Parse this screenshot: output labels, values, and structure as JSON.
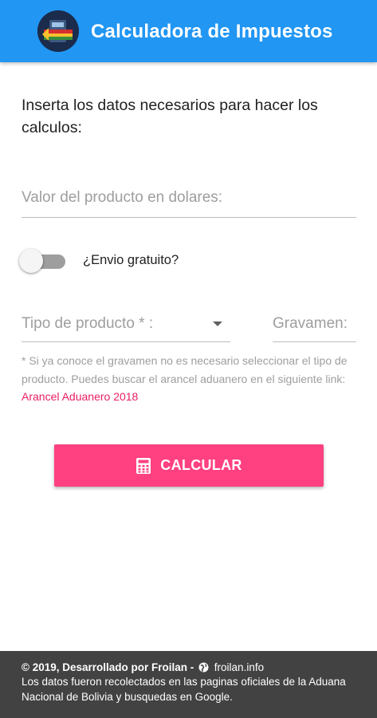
{
  "appbar": {
    "title": "Calculadora de Impuestos",
    "color": "#2196f3",
    "logo_icon": "calculator-money-logo"
  },
  "intro": {
    "text": "Inserta los datos necesarios para hacer los calculos:"
  },
  "form": {
    "valor": {
      "placeholder": "Valor del producto en dolares:",
      "value": ""
    },
    "envio": {
      "label": "¿Envio gratuito?",
      "checked": false
    },
    "tipo": {
      "placeholder": "Tipo de producto * :",
      "icon": "dropdown-arrow-icon"
    },
    "gravamen": {
      "placeholder": "Gravamen:",
      "value": ""
    },
    "help": {
      "text": "* Si ya conoce el gravamen no es necesario seleccionar el tipo de producto. Puedes buscar el arancel aduanero en el siguiente link: ",
      "link_text": "Arancel Aduanero 2018"
    }
  },
  "button": {
    "label": "CALCULAR",
    "icon": "calculator-icon",
    "color": "#ff4081"
  },
  "footer": {
    "credit": "© 2019, Desarrollado por Froilan -",
    "website": "froilan.info",
    "website_icon": "globe-icon",
    "note": "Los datos fueron recolectados en las paginas oficiales de la Aduana Nacional de Bolivia y busquedas en Google."
  }
}
